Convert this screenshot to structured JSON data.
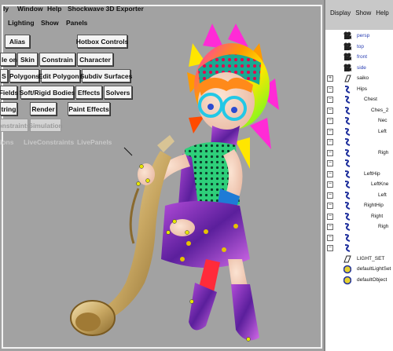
{
  "hotbox": {
    "top_menus": [
      "ly",
      "Window",
      "Help",
      "Shockwave 3D Exporter"
    ],
    "row2": [
      "Lighting",
      "Show",
      "Panels"
    ],
    "alias_label": "Alias",
    "hotbox_controls_label": "Hotbox Controls",
    "row4": [
      "le on",
      "Skin",
      "Constrain",
      "Character"
    ],
    "row5": [
      "S",
      "Polygons",
      "Edit Polygons",
      "Subdiv Surfaces"
    ],
    "row6": [
      "Fields",
      "Soft/Rigid Bodies",
      "Effects",
      "Solvers"
    ],
    "row7": [
      "tring",
      "Render",
      "Paint Effects"
    ],
    "row8": [
      "onstraints",
      "Simulation"
    ],
    "row9": [
      "ions",
      "LiveConstraints",
      "LivePanels"
    ]
  },
  "outliner": {
    "menu": [
      "Display",
      "Show",
      "Help"
    ],
    "rows": [
      {
        "label": "persp",
        "indent": 0,
        "blue": true,
        "icon": "camera-icon",
        "expand": ""
      },
      {
        "label": "top",
        "indent": 0,
        "blue": true,
        "icon": "camera-icon",
        "expand": ""
      },
      {
        "label": "front",
        "indent": 0,
        "blue": true,
        "icon": "camera-icon",
        "expand": ""
      },
      {
        "label": "side",
        "indent": 0,
        "blue": true,
        "icon": "camera-icon",
        "expand": ""
      },
      {
        "label": "saiko",
        "indent": 0,
        "blue": false,
        "icon": "mesh-icon",
        "expand": "+"
      },
      {
        "label": "Hips",
        "indent": 0,
        "blue": false,
        "icon": "joint-icon",
        "expand": "−"
      },
      {
        "label": "Chest",
        "indent": 1,
        "blue": false,
        "icon": "joint-icon",
        "expand": "−"
      },
      {
        "label": "Ches_2",
        "indent": 2,
        "blue": false,
        "icon": "joint-icon",
        "expand": "−"
      },
      {
        "label": "Nec",
        "indent": 3,
        "blue": false,
        "icon": "joint-icon",
        "expand": "−"
      },
      {
        "label": "Left",
        "indent": 3,
        "blue": false,
        "icon": "joint-icon",
        "expand": "−"
      },
      {
        "label": "",
        "indent": 3,
        "blue": false,
        "icon": "joint-icon",
        "expand": "−"
      },
      {
        "label": "Righ",
        "indent": 3,
        "blue": false,
        "icon": "joint-icon",
        "expand": "−"
      },
      {
        "label": "",
        "indent": 3,
        "blue": false,
        "icon": "joint-icon",
        "expand": "−"
      },
      {
        "label": "LeftHip",
        "indent": 1,
        "blue": false,
        "icon": "joint-icon",
        "expand": "−"
      },
      {
        "label": "LeftKne",
        "indent": 2,
        "blue": false,
        "icon": "joint-icon",
        "expand": "−"
      },
      {
        "label": "Left",
        "indent": 3,
        "blue": false,
        "icon": "joint-icon",
        "expand": "−"
      },
      {
        "label": "RightHip",
        "indent": 1,
        "blue": false,
        "icon": "joint-icon",
        "expand": "−"
      },
      {
        "label": "Right",
        "indent": 2,
        "blue": false,
        "icon": "joint-icon",
        "expand": "−"
      },
      {
        "label": "Righ",
        "indent": 3,
        "blue": false,
        "icon": "joint-icon",
        "expand": "−"
      },
      {
        "label": "",
        "indent": 3,
        "blue": false,
        "icon": "joint-icon",
        "expand": "−"
      },
      {
        "label": "",
        "indent": 3,
        "blue": false,
        "icon": "joint-icon",
        "expand": "−"
      },
      {
        "label": "LIGHT_SET",
        "indent": 0,
        "blue": false,
        "icon": "set-icon",
        "expand": ""
      },
      {
        "label": "defaultLightSet",
        "indent": 0,
        "blue": false,
        "icon": "light-set-icon",
        "expand": ""
      },
      {
        "label": "defaultObject",
        "indent": 0,
        "blue": false,
        "icon": "light-set-icon",
        "expand": ""
      }
    ]
  }
}
